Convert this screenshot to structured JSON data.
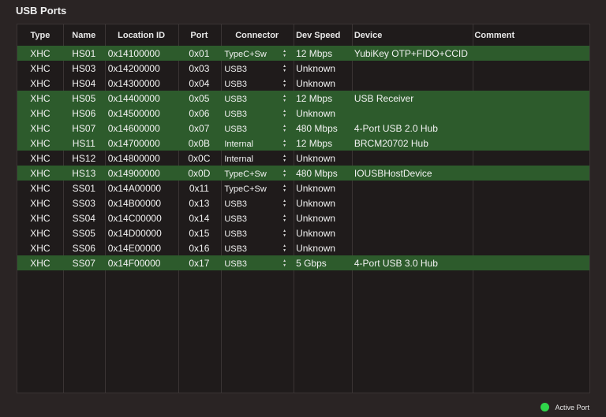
{
  "panel": {
    "title": "USB Ports"
  },
  "columns": {
    "type": "Type",
    "name": "Name",
    "location": "Location ID",
    "port": "Port",
    "connector": "Connector",
    "speed": "Dev Speed",
    "device": "Device",
    "comment": "Comment"
  },
  "rows": [
    {
      "type": "XHC",
      "name": "HS01",
      "location": "0x14100000",
      "port": "0x01",
      "connector": "TypeC+Sw",
      "speed": "12 Mbps",
      "device": "YubiKey OTP+FIDO+CCID",
      "comment": "",
      "active": true
    },
    {
      "type": "XHC",
      "name": "HS03",
      "location": "0x14200000",
      "port": "0x03",
      "connector": "USB3",
      "speed": "Unknown",
      "device": "",
      "comment": "",
      "active": false
    },
    {
      "type": "XHC",
      "name": "HS04",
      "location": "0x14300000",
      "port": "0x04",
      "connector": "USB3",
      "speed": "Unknown",
      "device": "",
      "comment": "",
      "active": false
    },
    {
      "type": "XHC",
      "name": "HS05",
      "location": "0x14400000",
      "port": "0x05",
      "connector": "USB3",
      "speed": "12 Mbps",
      "device": "USB Receiver",
      "comment": "",
      "active": true
    },
    {
      "type": "XHC",
      "name": "HS06",
      "location": "0x14500000",
      "port": "0x06",
      "connector": "USB3",
      "speed": "Unknown",
      "device": "",
      "comment": "",
      "active": true
    },
    {
      "type": "XHC",
      "name": "HS07",
      "location": "0x14600000",
      "port": "0x07",
      "connector": "USB3",
      "speed": "480 Mbps",
      "device": "4-Port USB 2.0 Hub",
      "comment": "",
      "active": true
    },
    {
      "type": "XHC",
      "name": "HS11",
      "location": "0x14700000",
      "port": "0x0B",
      "connector": "Internal",
      "speed": "12 Mbps",
      "device": "BRCM20702 Hub",
      "comment": "",
      "active": true
    },
    {
      "type": "XHC",
      "name": "HS12",
      "location": "0x14800000",
      "port": "0x0C",
      "connector": "Internal",
      "speed": "Unknown",
      "device": "",
      "comment": "",
      "active": false
    },
    {
      "type": "XHC",
      "name": "HS13",
      "location": "0x14900000",
      "port": "0x0D",
      "connector": "TypeC+Sw",
      "speed": "480 Mbps",
      "device": "IOUSBHostDevice",
      "comment": "",
      "active": true
    },
    {
      "type": "XHC",
      "name": "SS01",
      "location": "0x14A00000",
      "port": "0x11",
      "connector": "TypeC+Sw",
      "speed": "Unknown",
      "device": "",
      "comment": "",
      "active": false
    },
    {
      "type": "XHC",
      "name": "SS03",
      "location": "0x14B00000",
      "port": "0x13",
      "connector": "USB3",
      "speed": "Unknown",
      "device": "",
      "comment": "",
      "active": false
    },
    {
      "type": "XHC",
      "name": "SS04",
      "location": "0x14C00000",
      "port": "0x14",
      "connector": "USB3",
      "speed": "Unknown",
      "device": "",
      "comment": "",
      "active": false
    },
    {
      "type": "XHC",
      "name": "SS05",
      "location": "0x14D00000",
      "port": "0x15",
      "connector": "USB3",
      "speed": "Unknown",
      "device": "",
      "comment": "",
      "active": false
    },
    {
      "type": "XHC",
      "name": "SS06",
      "location": "0x14E00000",
      "port": "0x16",
      "connector": "USB3",
      "speed": "Unknown",
      "device": "",
      "comment": "",
      "active": false
    },
    {
      "type": "XHC",
      "name": "SS07",
      "location": "0x14F00000",
      "port": "0x17",
      "connector": "USB3",
      "speed": "5 Gbps",
      "device": "4-Port USB 3.0 Hub",
      "comment": "",
      "active": true
    }
  ],
  "legend": {
    "label": "Active Port",
    "color": "#2fd64a"
  },
  "colors": {
    "active_row": "#2d5b2c",
    "background": "#2a2424",
    "table_background": "#1f1b1b"
  },
  "icons": {
    "stepper": "up-down-chevron"
  }
}
